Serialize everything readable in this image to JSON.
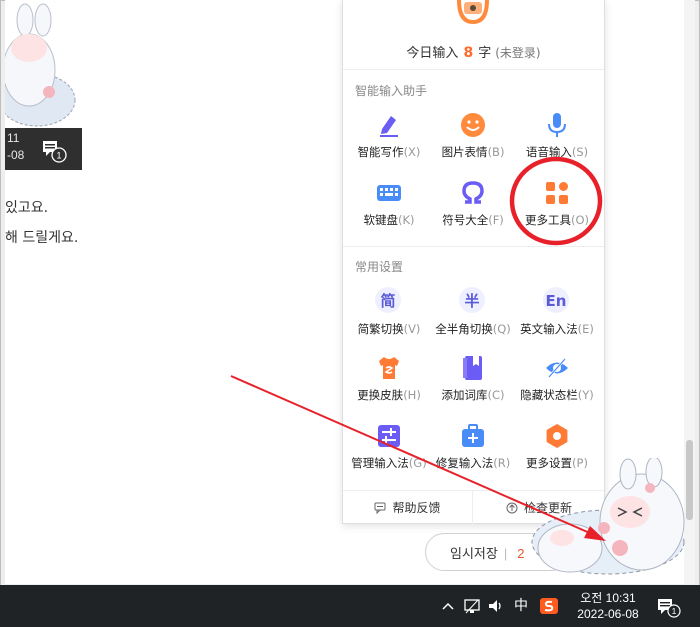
{
  "thumbnail": {
    "time_partial": "11",
    "date_partial": "-08",
    "comment_badge": "1"
  },
  "content_lines": [
    "있고요.",
    "해 드릴게요."
  ],
  "save_button": {
    "label": "임시저장",
    "count": "2"
  },
  "ime": {
    "today_prefix": "今日输入",
    "today_count": "8",
    "today_unit": "字",
    "login_status": "(未登录)",
    "sections": {
      "assistant_title": "智能输入助手",
      "settings_title": "常用设置"
    },
    "assistant_tools": [
      {
        "label": "智能写作",
        "key": "(X)",
        "icon": "pen-icon",
        "color": "#6b5cf5"
      },
      {
        "label": "图片表情",
        "key": "(B)",
        "icon": "smile-icon",
        "color": "#ff8a3c"
      },
      {
        "label": "语音输入",
        "key": "(S)",
        "icon": "mic-icon",
        "color": "#4a8cf7"
      },
      {
        "label": "软键盘",
        "key": "(K)",
        "icon": "keyboard-icon",
        "color": "#4a8cf7"
      },
      {
        "label": "符号大全",
        "key": "(F)",
        "icon": "omega-icon",
        "color": "#6b5cf5"
      },
      {
        "label": "更多工具",
        "key": "(O)",
        "icon": "apps-icon",
        "color": "#ff7a35"
      }
    ],
    "settings_tools": [
      {
        "label": "简繁切换",
        "key": "(V)",
        "icon": "jian-icon",
        "glyph": "简"
      },
      {
        "label": "全半角切换",
        "key": "(Q)",
        "icon": "ban-icon",
        "glyph": "半"
      },
      {
        "label": "英文输入法",
        "key": "(E)",
        "icon": "en-icon",
        "glyph": "En"
      },
      {
        "label": "更换皮肤",
        "key": "(H)",
        "icon": "shirt-icon",
        "color": "#ff7a35"
      },
      {
        "label": "添加词库",
        "key": "(C)",
        "icon": "book-icon",
        "color": "#6b5cf5"
      },
      {
        "label": "隐藏状态栏",
        "key": "(Y)",
        "icon": "eye-hidden-icon",
        "color": "#4a8cf7"
      },
      {
        "label": "管理输入法",
        "key": "(G)",
        "icon": "manage-icon",
        "color": "#6b5cf5"
      },
      {
        "label": "修复输入法",
        "key": "(R)",
        "icon": "toolbox-icon",
        "color": "#4a8cf7"
      },
      {
        "label": "更多设置",
        "key": "(P)",
        "icon": "hex-gear-icon",
        "color": "#ff7a35"
      }
    ],
    "footer": {
      "feedback": "帮助反馈",
      "update": "检查更新"
    }
  },
  "taskbar": {
    "ime_mode": "中",
    "time": "오전 10:31",
    "date": "2022-06-08",
    "notification_badge": "1"
  },
  "colors": {
    "accent": "#ff6a2c",
    "annotation": "#e8202a",
    "taskbar": "#1f2326"
  }
}
